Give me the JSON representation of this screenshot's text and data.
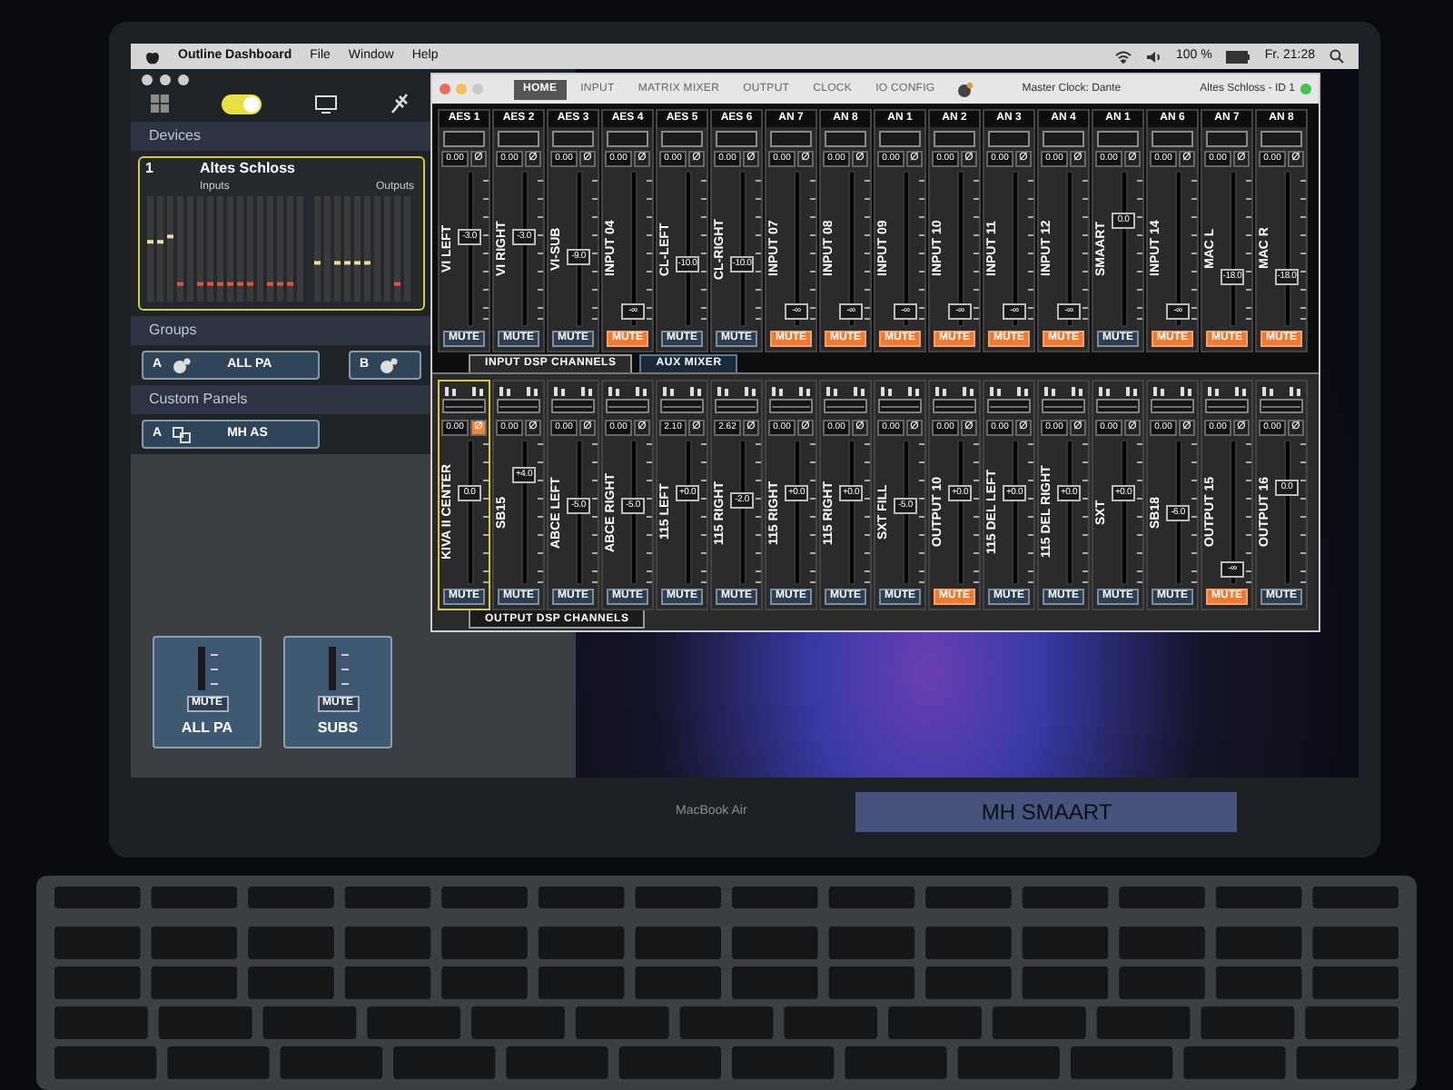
{
  "menu_bar": {
    "app": "Outline Dashboard",
    "menus": [
      "File",
      "Window",
      "Help"
    ],
    "battery": "100 %",
    "clock": "Fr. 21:28"
  },
  "sidebar": {
    "toggle_on": true,
    "devices_title": "Devices",
    "device": {
      "number": "1",
      "name": "Altes Schloss",
      "inputs_label": "Inputs",
      "outputs_label": "Outputs",
      "selected": true
    },
    "groups_title": "Groups",
    "groups": [
      {
        "letter": "A",
        "name": "ALL PA"
      },
      {
        "letter": "B"
      }
    ],
    "custom_panels_title": "Custom Panels",
    "custom_panels": [
      {
        "letter": "A",
        "name": "MH AS"
      }
    ],
    "group_faders": [
      {
        "name": "ALL PA",
        "mute": "MUTE",
        "muted": false
      },
      {
        "name": "SUBS",
        "mute": "MUTE",
        "muted": false
      }
    ]
  },
  "window": {
    "tabs": [
      {
        "label": "HOME",
        "selected": true
      },
      {
        "label": "INPUT",
        "selected": false
      },
      {
        "label": "MATRIX MIXER",
        "selected": false
      },
      {
        "label": "OUTPUT",
        "selected": false
      },
      {
        "label": "CLOCK",
        "selected": false
      },
      {
        "label": "IO CONFIG",
        "selected": false
      }
    ],
    "master_clock": "Master Clock: Dante",
    "device": "Altes Schloss - ID 1",
    "online": true,
    "inputs": [
      {
        "source": "AES 1",
        "gain": "0.00",
        "phase": "Ø",
        "name": "VI LEFT",
        "fader": "-3.0",
        "level": 0.6,
        "mute": "MUTE",
        "muted": false
      },
      {
        "source": "AES 2",
        "gain": "0.00",
        "phase": "Ø",
        "name": "VI RIGHT",
        "fader": "-3.0",
        "level": 0.6,
        "mute": "MUTE",
        "muted": false
      },
      {
        "source": "AES 3",
        "gain": "0.00",
        "phase": "Ø",
        "name": "VI-SUB",
        "fader": "-9.0",
        "level": 0.45,
        "mute": "MUTE",
        "muted": false
      },
      {
        "source": "AES 4",
        "gain": "0.00",
        "phase": "Ø",
        "name": "INPUT 04",
        "fader": "-∞",
        "level": 0.05,
        "mute": "MUTE",
        "muted": true
      },
      {
        "source": "AES 5",
        "gain": "0.00",
        "phase": "Ø",
        "name": "CL-LEFT",
        "fader": "-10.0",
        "level": 0.4,
        "mute": "MUTE",
        "muted": false
      },
      {
        "source": "AES 6",
        "gain": "0.00",
        "phase": "Ø",
        "name": "CL-RIGHT",
        "fader": "-10.0",
        "level": 0.4,
        "mute": "MUTE",
        "muted": false
      },
      {
        "source": "AN 7",
        "gain": "0.00",
        "phase": "Ø",
        "name": "INPUT 07",
        "fader": "-∞",
        "level": 0.05,
        "mute": "MUTE",
        "muted": true
      },
      {
        "source": "AN 8",
        "gain": "0.00",
        "phase": "Ø",
        "name": "INPUT 08",
        "fader": "-∞",
        "level": 0.05,
        "mute": "MUTE",
        "muted": true
      },
      {
        "source": "AN 1",
        "gain": "0.00",
        "phase": "Ø",
        "name": "INPUT 09",
        "fader": "-∞",
        "level": 0.05,
        "mute": "MUTE",
        "muted": true
      },
      {
        "source": "AN 2",
        "gain": "0.00",
        "phase": "Ø",
        "name": "INPUT 10",
        "fader": "-∞",
        "level": 0.05,
        "mute": "MUTE",
        "muted": true
      },
      {
        "source": "AN 3",
        "gain": "0.00",
        "phase": "Ø",
        "name": "INPUT 11",
        "fader": "-∞",
        "level": 0.05,
        "mute": "MUTE",
        "muted": true
      },
      {
        "source": "AN 4",
        "gain": "0.00",
        "phase": "Ø",
        "name": "INPUT 12",
        "fader": "-∞",
        "level": 0.05,
        "mute": "MUTE",
        "muted": true
      },
      {
        "source": "AN 1",
        "gain": "0.00",
        "phase": "Ø",
        "name": "SMAART",
        "fader": "0.0",
        "level": 0.72,
        "mute": "MUTE",
        "muted": false
      },
      {
        "source": "AN 6",
        "gain": "0.00",
        "phase": "Ø",
        "name": "INPUT 14",
        "fader": "-∞",
        "level": 0.05,
        "mute": "MUTE",
        "muted": true
      },
      {
        "source": "AN 7",
        "gain": "0.00",
        "phase": "Ø",
        "name": "MAC L",
        "fader": "-18.0",
        "level": 0.3,
        "mute": "MUTE",
        "muted": true
      },
      {
        "source": "AN 8",
        "gain": "0.00",
        "phase": "Ø",
        "name": "MAC R",
        "fader": "-18.0",
        "level": 0.3,
        "mute": "MUTE",
        "muted": true
      }
    ],
    "section_tabs": [
      {
        "label": "INPUT DSP CHANNELS",
        "selected": true
      },
      {
        "label": "AUX MIXER",
        "selected": false
      }
    ],
    "outputs": [
      {
        "gain": "0.00",
        "phase": "Ø",
        "phase_on": true,
        "name": "KIVA II CENTER",
        "fader": "0.0",
        "level": 0.65,
        "mute": "MUTE",
        "muted": false,
        "selected": true
      },
      {
        "gain": "0.00",
        "phase": "Ø",
        "phase_on": false,
        "name": "SB15",
        "fader": "+4.0",
        "level": 0.8,
        "mute": "MUTE",
        "muted": false,
        "selected": false
      },
      {
        "gain": "0.00",
        "phase": "Ø",
        "phase_on": false,
        "name": "ABCE LEFT",
        "fader": "-5.0",
        "level": 0.55,
        "mute": "MUTE",
        "muted": false,
        "selected": false
      },
      {
        "gain": "0.00",
        "phase": "Ø",
        "phase_on": false,
        "name": "ABCE RIGHT",
        "fader": "-5.0",
        "level": 0.55,
        "mute": "MUTE",
        "muted": false,
        "selected": false
      },
      {
        "gain": "2.10",
        "phase": "Ø",
        "phase_on": false,
        "name": "115 LEFT",
        "fader": "+0.0",
        "level": 0.65,
        "mute": "MUTE",
        "muted": false,
        "selected": false
      },
      {
        "gain": "2.62",
        "phase": "Ø",
        "phase_on": false,
        "name": "115 RIGHT",
        "fader": "-2.0",
        "level": 0.6,
        "mute": "MUTE",
        "muted": false,
        "selected": false
      },
      {
        "gain": "0.00",
        "phase": "Ø",
        "phase_on": false,
        "name": "115 RIGHT",
        "fader": "+0.0",
        "level": 0.65,
        "mute": "MUTE",
        "muted": false,
        "selected": false
      },
      {
        "gain": "0.00",
        "phase": "Ø",
        "phase_on": false,
        "name": "115 RIGHT",
        "fader": "+0.0",
        "level": 0.65,
        "mute": "MUTE",
        "muted": false,
        "selected": false
      },
      {
        "gain": "0.00",
        "phase": "Ø",
        "phase_on": false,
        "name": "SXT FILL",
        "fader": "-5.0",
        "level": 0.55,
        "mute": "MUTE",
        "muted": false,
        "selected": false
      },
      {
        "gain": "0.00",
        "phase": "Ø",
        "phase_on": false,
        "name": "OUTPUT 10",
        "fader": "+0.0",
        "level": 0.65,
        "mute": "MUTE",
        "muted": true,
        "selected": false
      },
      {
        "gain": "0.00",
        "phase": "Ø",
        "phase_on": false,
        "name": "115 DEL LEFT",
        "fader": "+0.0",
        "level": 0.65,
        "mute": "MUTE",
        "muted": false,
        "selected": false
      },
      {
        "gain": "0.00",
        "phase": "Ø",
        "phase_on": false,
        "name": "115 DEL RIGHT",
        "fader": "+0.0",
        "level": 0.65,
        "mute": "MUTE",
        "muted": false,
        "selected": false
      },
      {
        "gain": "0.00",
        "phase": "Ø",
        "phase_on": false,
        "name": "SXT",
        "fader": "+0.0",
        "level": 0.65,
        "mute": "MUTE",
        "muted": false,
        "selected": false
      },
      {
        "gain": "0.00",
        "phase": "Ø",
        "phase_on": false,
        "name": "SB18",
        "fader": "-6.0",
        "level": 0.5,
        "mute": "MUTE",
        "muted": false,
        "selected": false
      },
      {
        "gain": "0.00",
        "phase": "Ø",
        "phase_on": false,
        "name": "OUTPUT 15",
        "fader": "-∞",
        "level": 0.05,
        "mute": "MUTE",
        "muted": true,
        "selected": false
      },
      {
        "gain": "0.00",
        "phase": "Ø",
        "phase_on": false,
        "name": "OUTPUT 16",
        "fader": "0.0",
        "level": 0.7,
        "mute": "MUTE",
        "muted": false,
        "selected": false
      }
    ],
    "outputs_label": "OUTPUT DSP CHANNELS"
  },
  "laptop": {
    "model": "MacBook Air",
    "sticker": "MH SMAART"
  }
}
